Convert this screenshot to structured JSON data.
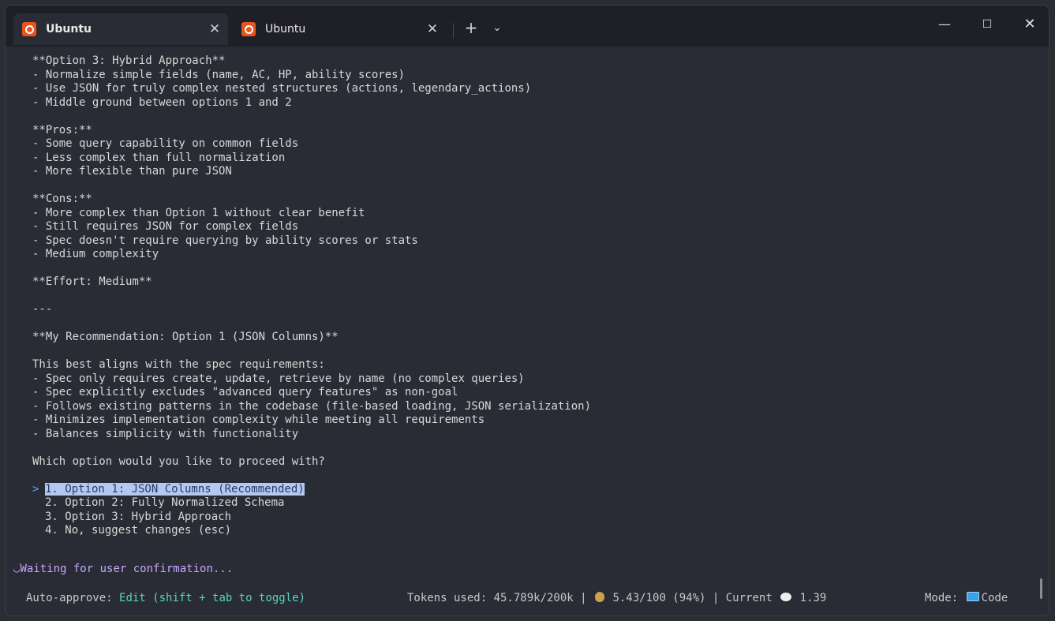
{
  "tabs": [
    {
      "label": "Ubuntu",
      "active": true
    },
    {
      "label": "Ubuntu",
      "active": false
    }
  ],
  "icons": {
    "tab_icon": "ubuntu-logo-icon",
    "tab_close": "close-icon",
    "new_tab": "plus-icon",
    "tab_dropdown": "chevron-down-icon",
    "minimize": "minimize-icon",
    "maximize": "maximize-icon",
    "close_window": "close-icon",
    "cost": "money-bag-icon",
    "current": "speech-bubble-icon",
    "mode": "laptop-icon",
    "spinner": "spinner-icon"
  },
  "glyphs": {
    "tab_close": "✕",
    "new_tab": "+",
    "tab_dropdown": "⌄",
    "minimize": "—",
    "maximize": "☐",
    "close_window": "✕",
    "selection_marker": ">",
    "spinner": "◡"
  },
  "terminal_lines": [
    "**Option 3: Hybrid Approach**",
    "- Normalize simple fields (name, AC, HP, ability scores)",
    "- Use JSON for truly complex nested structures (actions, legendary_actions)",
    "- Middle ground between options 1 and 2",
    "",
    "**Pros:**",
    "- Some query capability on common fields",
    "- Less complex than full normalization",
    "- More flexible than pure JSON",
    "",
    "**Cons:**",
    "- More complex than Option 1 without clear benefit",
    "- Still requires JSON for complex fields",
    "- Spec doesn't require querying by ability scores or stats",
    "- Medium complexity",
    "",
    "**Effort: Medium**",
    "",
    "---",
    "",
    "**My Recommendation: Option 1 (JSON Columns)**",
    "",
    "This best aligns with the spec requirements:",
    "- Spec only requires create, update, retrieve by name (no complex queries)",
    "- Spec explicitly excludes \"advanced query features\" as non-goal",
    "- Follows existing patterns in the codebase (file-based loading, JSON serialization)",
    "- Minimizes implementation complexity while meeting all requirements",
    "- Balances simplicity with functionality",
    "",
    "Which option would you like to proceed with?",
    ""
  ],
  "options": [
    {
      "label": "1. Option 1: JSON Columns (Recommended)",
      "selected": true
    },
    {
      "label": "2. Option 2: Fully Normalized Schema",
      "selected": false
    },
    {
      "label": "3. Option 3: Hybrid Approach",
      "selected": false
    },
    {
      "label": "4. No, suggest changes (esc)",
      "selected": false
    }
  ],
  "status_message": "Waiting for user confirmation...",
  "status_bar": {
    "auto_approve_label": "Auto-approve:",
    "auto_approve_value": "Edit (shift + tab to toggle)",
    "tokens": "Tokens used: 45.789k/200k |",
    "cost": "5.43/100 (94%) | Current",
    "current_value": "1.39",
    "mode_label": "Mode:",
    "mode_value": "Code"
  },
  "colors": {
    "background": "#2a2c35",
    "titlebar": "#1f2027",
    "text": "#d8d8d8",
    "accent_teal": "#59d3c3",
    "waiting_purple": "#c7a7ff",
    "selection_bg": "#b4c8f0",
    "ubuntu_orange": "#e95420"
  }
}
